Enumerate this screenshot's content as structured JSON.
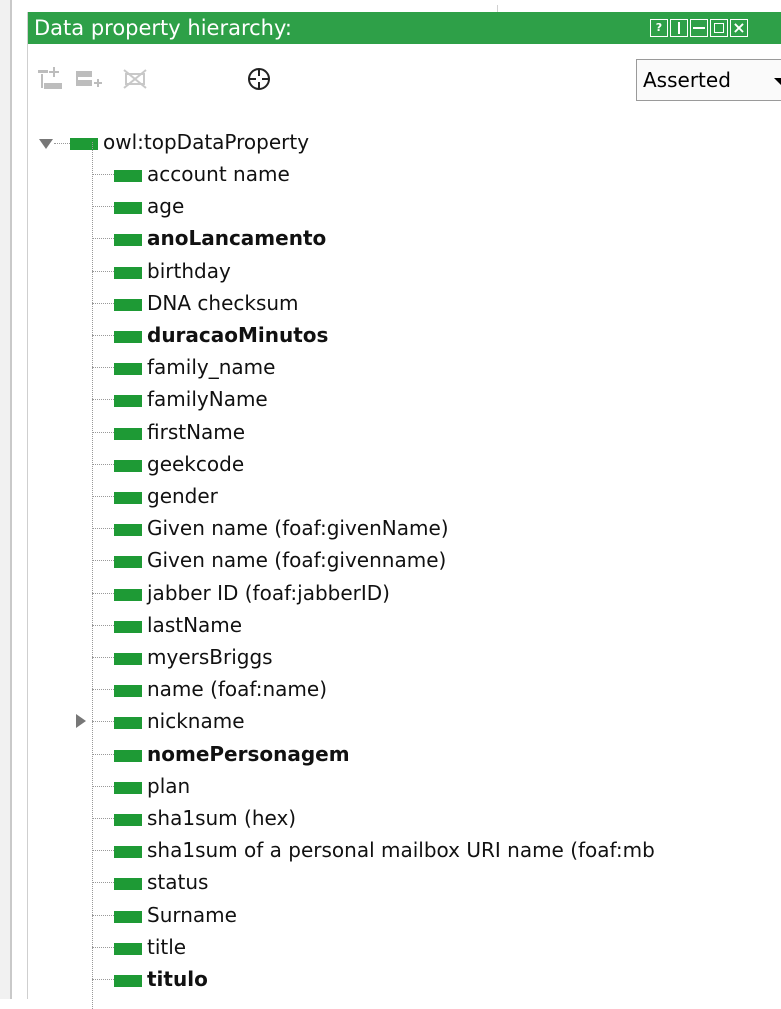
{
  "window": {
    "title": "Data property hierarchy:",
    "accent_color": "#2ea048",
    "title_buttons": [
      "help-icon",
      "split-vertical-icon",
      "split-horizontal-icon",
      "maximize-icon",
      "close-icon"
    ]
  },
  "toolbar": {
    "icons": [
      "add-subproperty-icon",
      "add-sibling-icon",
      "delete-icon",
      "target-icon"
    ],
    "view_mode": "Asserted"
  },
  "tree": {
    "root": "owl:topDataProperty",
    "root_expanded": true,
    "swatch_color": "#1e9a35",
    "items": [
      {
        "label": "account name",
        "bold": false
      },
      {
        "label": "age",
        "bold": false
      },
      {
        "label": "anoLancamento",
        "bold": true
      },
      {
        "label": "birthday",
        "bold": false
      },
      {
        "label": "DNA checksum",
        "bold": false
      },
      {
        "label": "duracaoMinutos",
        "bold": true
      },
      {
        "label": "family_name",
        "bold": false
      },
      {
        "label": "familyName",
        "bold": false
      },
      {
        "label": "firstName",
        "bold": false
      },
      {
        "label": "geekcode",
        "bold": false
      },
      {
        "label": "gender",
        "bold": false
      },
      {
        "label": "Given name (foaf:givenName)",
        "bold": false
      },
      {
        "label": "Given name (foaf:givenname)",
        "bold": false
      },
      {
        "label": "jabber ID (foaf:jabberID)",
        "bold": false
      },
      {
        "label": "lastName",
        "bold": false
      },
      {
        "label": "myersBriggs",
        "bold": false
      },
      {
        "label": "name (foaf:name)",
        "bold": false
      },
      {
        "label": "nickname",
        "bold": false,
        "expandable": true
      },
      {
        "label": "nomePersonagem",
        "bold": true
      },
      {
        "label": "plan",
        "bold": false
      },
      {
        "label": "sha1sum (hex)",
        "bold": false
      },
      {
        "label": "sha1sum of a personal mailbox URI name (foaf:mb",
        "bold": false
      },
      {
        "label": "status",
        "bold": false
      },
      {
        "label": "Surname",
        "bold": false
      },
      {
        "label": "title",
        "bold": false
      },
      {
        "label": "titulo",
        "bold": true
      }
    ]
  }
}
